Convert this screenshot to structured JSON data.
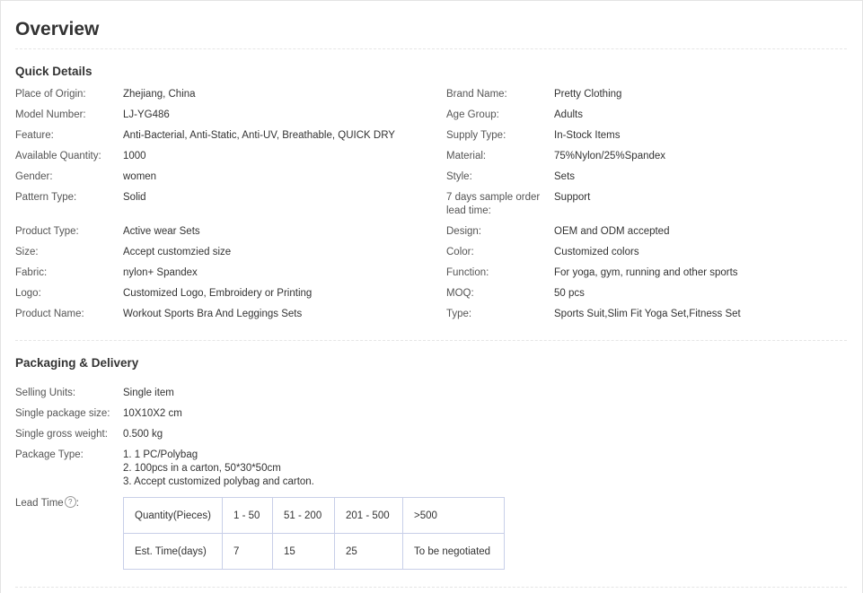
{
  "title": "Overview",
  "quick_details": {
    "heading": "Quick Details",
    "left": [
      {
        "label": "Place of Origin:",
        "value": "Zhejiang, China"
      },
      {
        "label": "Model Number:",
        "value": "LJ-YG486"
      },
      {
        "label": "Feature:",
        "value": "Anti-Bacterial, Anti-Static, Anti-UV, Breathable, QUICK DRY"
      },
      {
        "label": "Available Quantity:",
        "value": "1000"
      },
      {
        "label": "Gender:",
        "value": "women"
      },
      {
        "label": "Pattern Type:",
        "value": "Solid"
      },
      {
        "label": "Product Type:",
        "value": "Active wear Sets"
      },
      {
        "label": "Size:",
        "value": "Accept customzied size"
      },
      {
        "label": "Fabric:",
        "value": "nylon+ Spandex"
      },
      {
        "label": "Logo:",
        "value": "Customized Logo, Embroidery or Printing"
      },
      {
        "label": "Product Name:",
        "value": "Workout Sports Bra And Leggings Sets"
      }
    ],
    "right": [
      {
        "label": "Brand Name:",
        "value": "Pretty Clothing"
      },
      {
        "label": "Age Group:",
        "value": "Adults"
      },
      {
        "label": "Supply Type:",
        "value": "In-Stock Items"
      },
      {
        "label": "Material:",
        "value": "75%Nylon/25%Spandex"
      },
      {
        "label": "Style:",
        "value": "Sets"
      },
      {
        "label": "7 days sample order lead time:",
        "value": "Support"
      },
      {
        "label": "Design:",
        "value": "OEM and ODM accepted"
      },
      {
        "label": "Color:",
        "value": "Customized colors"
      },
      {
        "label": "Function:",
        "value": "For yoga, gym, running and other sports"
      },
      {
        "label": "MOQ:",
        "value": "50 pcs"
      },
      {
        "label": "Type:",
        "value": "Sports Suit,Slim Fit Yoga Set,Fitness Set"
      }
    ]
  },
  "packaging": {
    "heading": "Packaging & Delivery",
    "items": [
      {
        "label": "Selling Units:",
        "value": "Single item"
      },
      {
        "label": "Single package size:",
        "value": "10X10X2 cm"
      },
      {
        "label": "Single gross weight:",
        "value": "0.500 kg"
      }
    ],
    "package_type": {
      "label": "Package Type:",
      "lines": [
        "1. 1 PC/Polybag",
        "2. 100pcs in a carton, 50*30*50cm",
        "3. Accept customized polybag and carton."
      ]
    },
    "lead_time": {
      "label": "Lead Time",
      "help_icon": "question-circle-icon",
      "help_glyph": "?",
      "suffix": ":",
      "row_quantity": [
        "Quantity(Pieces)",
        "1 - 50",
        "51 - 200",
        "201 - 500",
        ">500"
      ],
      "row_time": [
        "Est. Time(days)",
        "7",
        "15",
        "25",
        "To be negotiated"
      ]
    }
  }
}
